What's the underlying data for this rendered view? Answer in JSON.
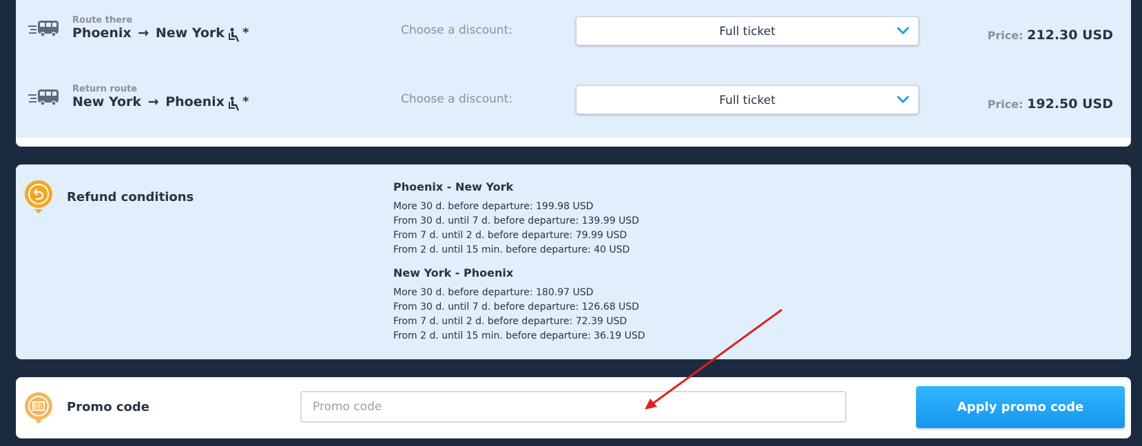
{
  "routes": [
    {
      "direction_label": "Route there",
      "from": "Phoenix",
      "to": "New York",
      "seat_icon": "seated-passenger-icon",
      "seat_marker": "*",
      "discount_label": "Choose a discount:",
      "discount_value": "Full ticket",
      "price_label": "Price:",
      "price_value": "212.30 USD"
    },
    {
      "direction_label": "Return route",
      "from": "New York",
      "to": "Phoenix",
      "seat_icon": "seated-passenger-icon",
      "seat_marker": "*",
      "discount_label": "Choose a discount:",
      "discount_value": "Full ticket",
      "price_label": "Price:",
      "price_value": "192.50 USD"
    }
  ],
  "refund": {
    "title": "Refund conditions",
    "icon": "return-arrow-icon",
    "blocks": [
      {
        "heading": "Phoenix - New York",
        "lines": [
          "More 30 d. before departure: 199.98 USD",
          "From 30 d. until 7 d. before departure: 139.99 USD",
          "From 7 d. until 2 d. before departure: 79.99 USD",
          "From 2 d. until 15 min. before departure: 40 USD"
        ]
      },
      {
        "heading": "New York - Phoenix",
        "lines": [
          "More 30 d. before departure: 180.97 USD",
          "From 30 d. until 7 d. before departure: 126.68 USD",
          "From 7 d. until 2 d. before departure: 72.39 USD",
          "From 2 d. until 15 min. before departure: 36.19 USD"
        ]
      }
    ]
  },
  "promo": {
    "title": "Promo code",
    "icon": "barcode-icon",
    "input_placeholder": "Promo code",
    "input_value": "",
    "apply_label": "Apply promo code"
  },
  "colors": {
    "page_background": "#1b2a3e",
    "panel_background": "#e1eefb",
    "accent_blue": "#1e9ff0",
    "icon_orange": "#f5a623",
    "annotation_red": "#e0201c"
  }
}
